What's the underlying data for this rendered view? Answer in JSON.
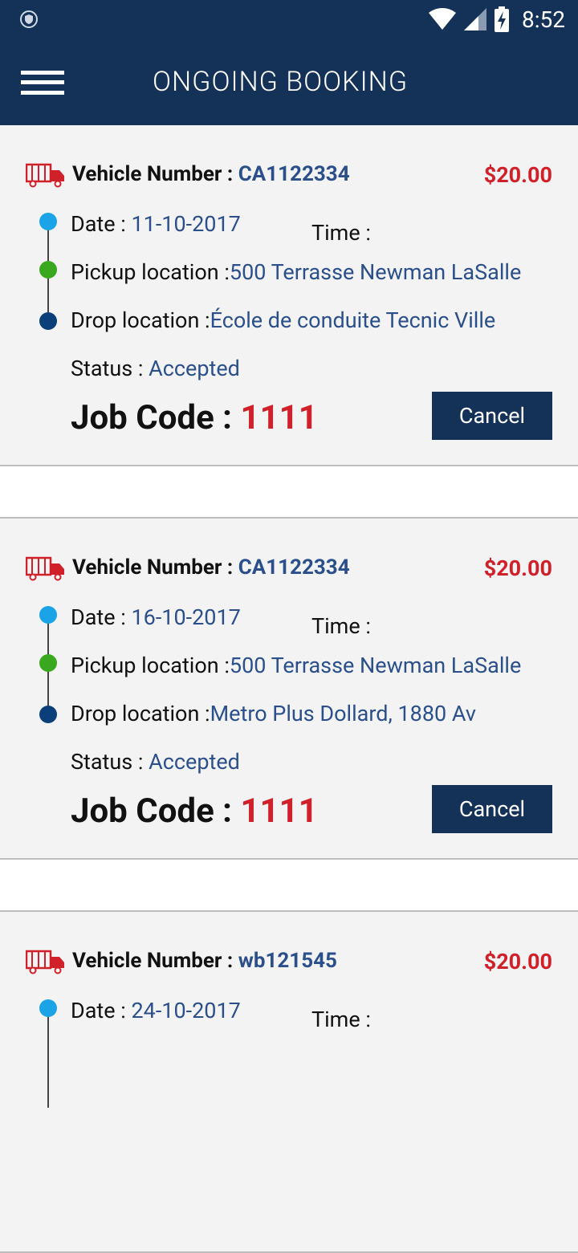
{
  "status_bar": {
    "time": "8:52"
  },
  "app_bar": {
    "title": "ONGOING BOOKING"
  },
  "labels": {
    "vehicle_number": "Vehicle Number : ",
    "date": "Date : ",
    "time": "Time :",
    "pickup": "Pickup location :",
    "drop": "Drop location :",
    "status": "Status : ",
    "job_code": "Job Code : ",
    "cancel": "Cancel"
  },
  "colors": {
    "primary": "#143257",
    "value_blue": "#2a4f8a",
    "price_red": "#d0202a",
    "dot_date": "#1aa3e6",
    "dot_pickup": "#3aa81e",
    "dot_drop": "#0b3f7a"
  },
  "bookings": [
    {
      "vehicle": "CA1122334",
      "price": "$20.00",
      "date": "11-10-2017",
      "pickup": "500 Terrasse Newman LaSalle",
      "drop": "École de conduite Tecnic Ville",
      "status": "Accepted",
      "job_code": "1111"
    },
    {
      "vehicle": "CA1122334",
      "price": "$20.00",
      "date": "16-10-2017",
      "pickup": "500 Terrasse Newman LaSalle",
      "drop": "Metro Plus Dollard, 1880 Av",
      "status": "Accepted",
      "job_code": "1111"
    },
    {
      "vehicle": "wb121545",
      "price": "$20.00",
      "date": "24-10-2017"
    }
  ]
}
